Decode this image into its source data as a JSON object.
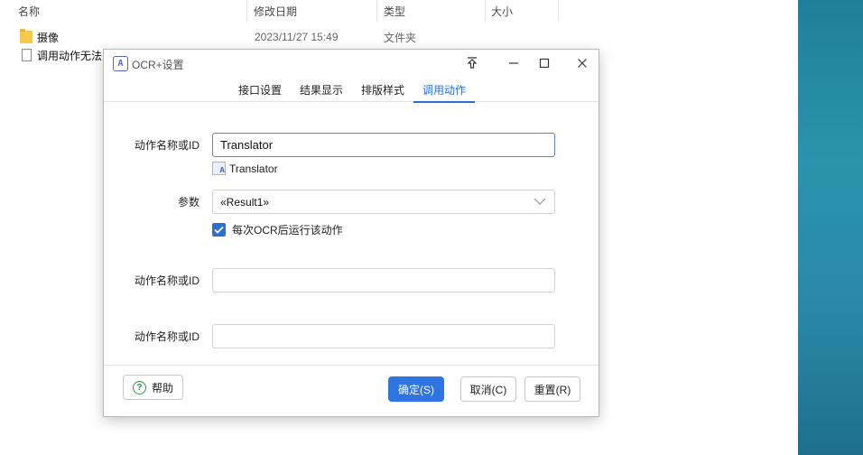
{
  "explorer": {
    "columns": {
      "name": "名称",
      "modified": "修改日期",
      "type": "类型",
      "size": "大小"
    },
    "files": [
      {
        "name": "摄像",
        "modified": "2023/11/27 15:49",
        "type": "文件夹",
        "icon": "folder-icon"
      },
      {
        "name": "调用动作无法",
        "modified": "",
        "type": "",
        "icon": "document-icon"
      }
    ]
  },
  "dialog": {
    "title": "OCR+设置",
    "app_icon_glyph": "A",
    "tabs": [
      {
        "label": "接口设置",
        "active": false
      },
      {
        "label": "结果显示",
        "active": false
      },
      {
        "label": "排版样式",
        "active": false
      },
      {
        "label": "调用动作",
        "active": true
      }
    ],
    "action1": {
      "label": "动作名称或ID",
      "value": "Translator",
      "suggestion": "Translator"
    },
    "params": {
      "label": "参数",
      "value": "«Result1»"
    },
    "run_after_ocr": {
      "label": "每次OCR后运行该动作",
      "checked": true
    },
    "action2": {
      "label": "动作名称或ID",
      "value": ""
    },
    "action3": {
      "label": "动作名称或ID",
      "value": ""
    },
    "buttons": {
      "help": "帮助",
      "ok": "确定(S)",
      "cancel": "取消(C)",
      "reset": "重置(R)"
    }
  },
  "colors": {
    "accent": "#2f74e0",
    "help_green": "#2a9a3a",
    "wallpaper": "#2a8aa8"
  }
}
